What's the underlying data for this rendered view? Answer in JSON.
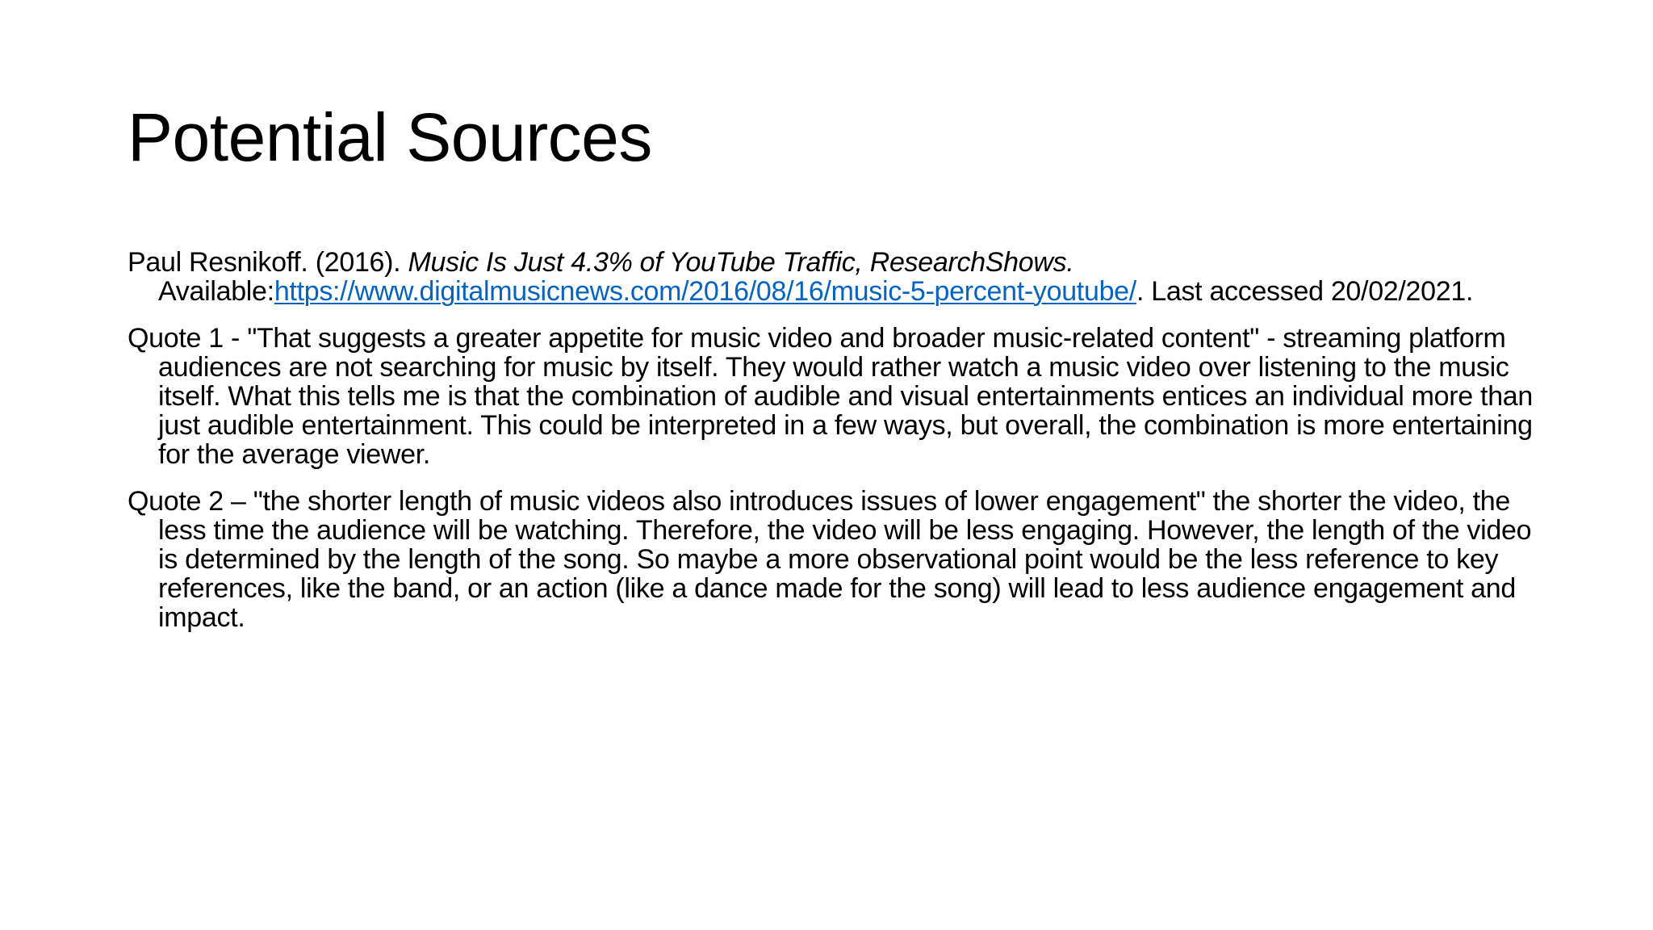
{
  "slide": {
    "title": "Potential Sources",
    "reference": {
      "author_year": "Paul Resnikoff. (2016). ",
      "work_title": "Music Is Just 4.3% of YouTube Traffic, ResearchShows.",
      "available_label": " Available:",
      "url": "https://www.digitalmusicnews.com/2016/08/16/music-5-percent-youtube/",
      "accessed": ". Last accessed 20/02/2021."
    },
    "quote1": "Quote 1 - \"That suggests a greater appetite for music video and broader music-related content\" - streaming platform audiences are not searching for music by itself. They would rather watch a music video over listening to the music itself. What this tells me is that the combination of audible and visual entertainments entices an individual more than just audible entertainment. This could be interpreted in a few ways, but overall, the combination is more entertaining for the average viewer.",
    "quote2": "Quote 2 – \"the shorter length of music videos also introduces issues of lower engagement\" the shorter the video, the less time the audience will be watching. Therefore, the video will be less engaging. However, the length of the video is determined by the length of the song. So maybe a more observational point would be the less reference to key references, like the band, or an action (like a dance made for the song) will lead to less audience engagement and impact."
  },
  "colors": {
    "background": "#ffffff",
    "text": "#000000",
    "link": "#0563c1"
  }
}
